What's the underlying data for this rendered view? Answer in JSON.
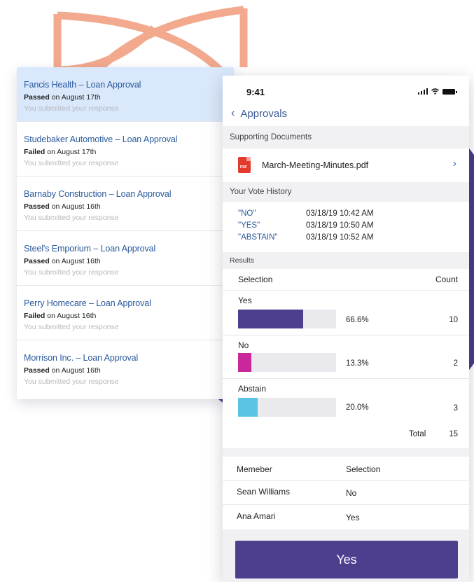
{
  "colors": {
    "accent_purple": "#4e3e8e",
    "link_blue": "#2a5a9c",
    "peach_decor": "#f2a98d",
    "bar_yes": "#4e3e8e",
    "bar_no": "#c8289a",
    "bar_abstain": "#5bc3e6"
  },
  "loan_list": [
    {
      "title": "Fancis Health – Loan Approval",
      "status": "Passed",
      "date": " on August 17th",
      "note": "You submitted your response",
      "selected": true
    },
    {
      "title": "Studebaker Automotive – Loan Approval",
      "status": "Failed",
      "date": " on August 17th",
      "note": "You submitted your response",
      "selected": false
    },
    {
      "title": "Barnaby Construction – Loan Approval",
      "status": "Passed",
      "date": " on August 16th",
      "note": "You submitted your response",
      "selected": false
    },
    {
      "title": "Steel's Emporium  – Loan Approval",
      "status": "Passed",
      "date": " on August 16th",
      "note": "You submitted your response",
      "selected": false
    },
    {
      "title": "Perry Homecare – Loan Approval",
      "status": "Failed",
      "date": " on August 16th",
      "note": "You submitted your response",
      "selected": false
    },
    {
      "title": "Morrison Inc. – Loan Approval",
      "status": "Passed",
      "date": " on August 16th",
      "note": "You submitted your response",
      "selected": false
    }
  ],
  "phone": {
    "status_bar": {
      "time": "9:41",
      "icons": [
        "signal-icon",
        "wifi-icon",
        "battery-icon"
      ]
    },
    "nav": {
      "back_icon": "chevron-left-icon",
      "title": "Approvals"
    },
    "supporting_documents": {
      "header": "Supporting Documents",
      "file_icon": "pdf-file-icon",
      "file_name": "March-Meeting-Minutes.pdf",
      "chevron_icon": "chevron-right-icon"
    },
    "vote_history": {
      "header": "Your Vote History",
      "entries": [
        {
          "choice": "\"NO\"",
          "time": "03/18/19 10:42 AM"
        },
        {
          "choice": "\"YES\"",
          "time": "03/18/19 10:50 AM"
        },
        {
          "choice": "\"ABSTAIN\"",
          "time": "03/18/19 10:52 AM"
        }
      ]
    },
    "results": {
      "header": "Results",
      "col_selection": "Selection",
      "col_count": "Count",
      "options": [
        {
          "label": "Yes",
          "percent_text": "66.6%",
          "fraction": 0.666,
          "count": "10",
          "color": "#4e3e8e"
        },
        {
          "label": "No",
          "percent_text": "13.3%",
          "fraction": 0.133,
          "count": "2",
          "color": "#c8289a"
        },
        {
          "label": "Abstain",
          "percent_text": "20.0%",
          "fraction": 0.2,
          "count": "3",
          "color": "#5bc3e6"
        }
      ],
      "total_label": "Total",
      "total_value": "15"
    },
    "members": {
      "col_member": "Memeber",
      "col_selection": "Selection",
      "rows": [
        {
          "name": "Sean Williams",
          "selection": "No"
        },
        {
          "name": "Ana Amari",
          "selection": "Yes"
        }
      ]
    },
    "vote_button_label": "Yes"
  }
}
